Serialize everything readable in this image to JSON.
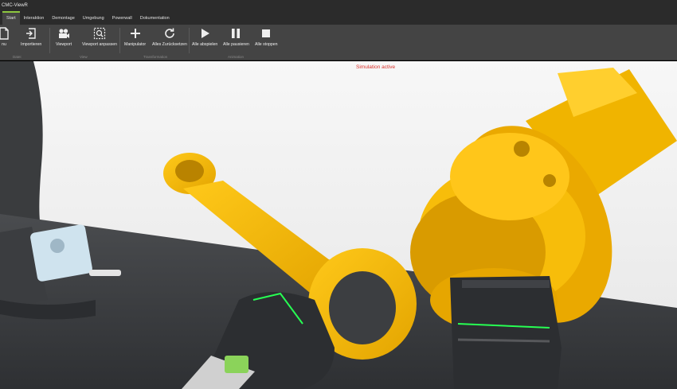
{
  "window": {
    "title": "CMC-ViewR"
  },
  "tabs": [
    {
      "label": "Start"
    },
    {
      "label": "Interaktion"
    },
    {
      "label": "Demontage"
    },
    {
      "label": "Umgebung"
    },
    {
      "label": "Powerwall"
    },
    {
      "label": "Dokumentation"
    }
  ],
  "ribbon": {
    "buttons": [
      {
        "label": "nu",
        "icon": "document-icon"
      },
      {
        "label": "Importieren",
        "icon": "import-icon"
      },
      {
        "label": "Viewport",
        "icon": "camera-icon"
      },
      {
        "label": "Viewport anpassen",
        "icon": "fit-viewport-icon"
      },
      {
        "label": "Manipulator",
        "icon": "move-icon"
      },
      {
        "label": "Alles Zurücksetzen",
        "icon": "reset-icon"
      },
      {
        "label": "Alle abspielen",
        "icon": "play-icon"
      },
      {
        "label": "Alle pausieren",
        "icon": "pause-icon"
      },
      {
        "label": "Alle stoppen",
        "icon": "stop-icon"
      }
    ],
    "groups": [
      "Datei",
      "View",
      "Transformation",
      "Animation"
    ]
  },
  "viewport": {
    "status": "Simulation active"
  },
  "colors": {
    "accent": "#8dc63f",
    "status": "#d9302a",
    "part": "#f2b80a"
  }
}
